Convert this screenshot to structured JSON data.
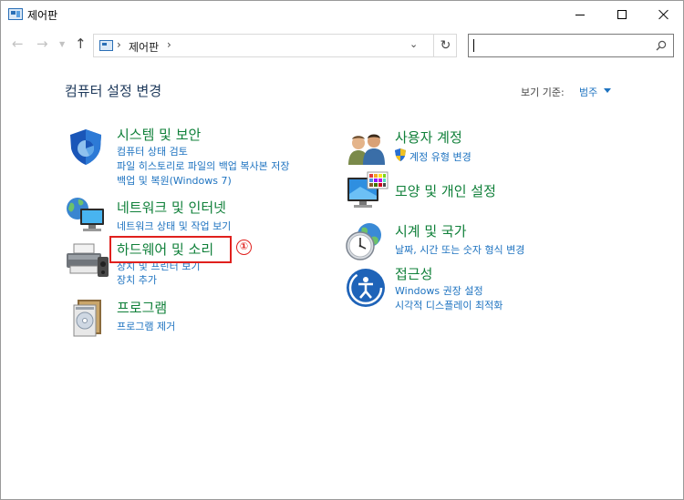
{
  "window": {
    "title": "제어판"
  },
  "address": {
    "path": "제어판"
  },
  "header": {
    "title": "컴퓨터 설정 변경",
    "view_label": "보기 기준:",
    "view_value": "범주"
  },
  "categories": [
    {
      "icon": "shield-icon",
      "title": "시스템 및 보안",
      "links": [
        "컴퓨터 상태 검토",
        "파일 히스토리로 파일의 백업 복사본 저장",
        "백업 및 복원(Windows 7)"
      ]
    },
    {
      "icon": "network-globe-icon",
      "title": "네트워크 및 인터넷",
      "links": [
        "네트워크 상태 및 작업 보기"
      ]
    },
    {
      "icon": "printer-speaker-icon",
      "title": "하드웨어 및 소리",
      "links": [
        "장치 및 프린터 보기",
        "장치 추가"
      ]
    },
    {
      "icon": "programs-disc-icon",
      "title": "프로그램",
      "links": [
        "프로그램 제거"
      ]
    },
    {
      "icon": "users-icon",
      "title": "사용자 계정",
      "links": [
        "계정 유형 변경"
      ]
    },
    {
      "icon": "monitor-palette-icon",
      "title": "모양 및 개인 설정",
      "links": []
    },
    {
      "icon": "clock-globe-icon",
      "title": "시계 및 국가",
      "links": [
        "날짜, 시간 또는 숫자 형식 변경"
      ]
    },
    {
      "icon": "ease-of-access-icon",
      "title": "접근성",
      "links": [
        "Windows 권장 설정",
        "시각적 디스플레이 최적화"
      ]
    }
  ],
  "annotation": {
    "badge": "①",
    "color": "#e0201d"
  },
  "colors": {
    "title_green": "#10803a",
    "link_blue": "#1e73c0",
    "heading": "#1e395b"
  }
}
